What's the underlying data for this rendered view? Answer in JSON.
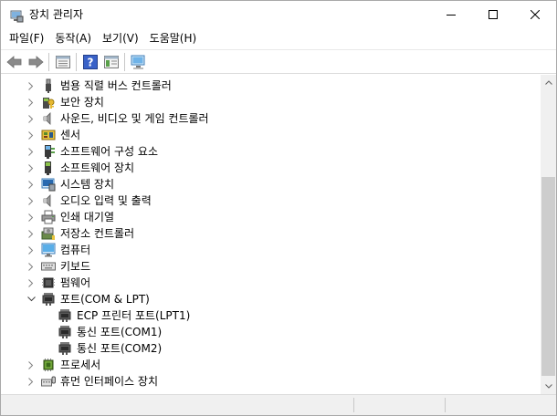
{
  "window": {
    "title": "장치 관리자",
    "controls": {
      "minimize_icon": "minimize-icon",
      "maximize_icon": "maximize-icon",
      "close_icon": "close-icon"
    }
  },
  "menu": {
    "items": [
      {
        "label": "파일(F)"
      },
      {
        "label": "동작(A)"
      },
      {
        "label": "보기(V)"
      },
      {
        "label": "도움말(H)"
      }
    ]
  },
  "toolbar": {
    "buttons": [
      "back-arrow-icon",
      "forward-arrow-icon",
      "properties-icon",
      "help-icon",
      "show-hide-console-tree-icon",
      "scan-hardware-icon"
    ]
  },
  "tree": {
    "items": [
      {
        "label": "범용 직렬 버스 컨트롤러",
        "icon": "usb-controller-icon",
        "expander": "collapsed",
        "level": 1
      },
      {
        "label": "보안 장치",
        "icon": "security-device-icon",
        "expander": "collapsed",
        "level": 1
      },
      {
        "label": "사운드, 비디오 및 게임 컨트롤러",
        "icon": "speaker-icon",
        "expander": "collapsed",
        "level": 1
      },
      {
        "label": "센서",
        "icon": "sensor-icon",
        "expander": "collapsed",
        "level": 1
      },
      {
        "label": "소프트웨어 구성 요소",
        "icon": "software-component-icon",
        "expander": "collapsed",
        "level": 1
      },
      {
        "label": "소프트웨어 장치",
        "icon": "software-device-icon",
        "expander": "collapsed",
        "level": 1
      },
      {
        "label": "시스템 장치",
        "icon": "system-device-icon",
        "expander": "collapsed",
        "level": 1
      },
      {
        "label": "오디오 입력 및 출력",
        "icon": "speaker-icon",
        "expander": "collapsed",
        "level": 1
      },
      {
        "label": "인쇄 대기열",
        "icon": "printer-icon",
        "expander": "collapsed",
        "level": 1
      },
      {
        "label": "저장소 컨트롤러",
        "icon": "storage-controller-icon",
        "expander": "collapsed",
        "level": 1
      },
      {
        "label": "컴퓨터",
        "icon": "monitor-icon",
        "expander": "collapsed",
        "level": 1
      },
      {
        "label": "키보드",
        "icon": "keyboard-icon",
        "expander": "collapsed",
        "level": 1
      },
      {
        "label": "펌웨어",
        "icon": "firmware-icon",
        "expander": "collapsed",
        "level": 1
      },
      {
        "label": "포트(COM & LPT)",
        "icon": "port-icon",
        "expander": "expanded",
        "level": 1
      },
      {
        "label": "ECP 프린터 포트(LPT1)",
        "icon": "port-icon",
        "expander": "none",
        "level": 2
      },
      {
        "label": "통신 포트(COM1)",
        "icon": "port-icon",
        "expander": "none",
        "level": 2
      },
      {
        "label": "통신 포트(COM2)",
        "icon": "port-icon",
        "expander": "none",
        "level": 2
      },
      {
        "label": "프로세서",
        "icon": "processor-icon",
        "expander": "collapsed",
        "level": 1
      },
      {
        "label": "휴먼 인터페이스 장치",
        "icon": "hid-icon",
        "expander": "collapsed",
        "level": 1
      }
    ]
  },
  "scrollbar": {
    "position": 0.86
  },
  "colors": {
    "accent": "#0078d7",
    "folder_yellow": "#e8c33d"
  }
}
